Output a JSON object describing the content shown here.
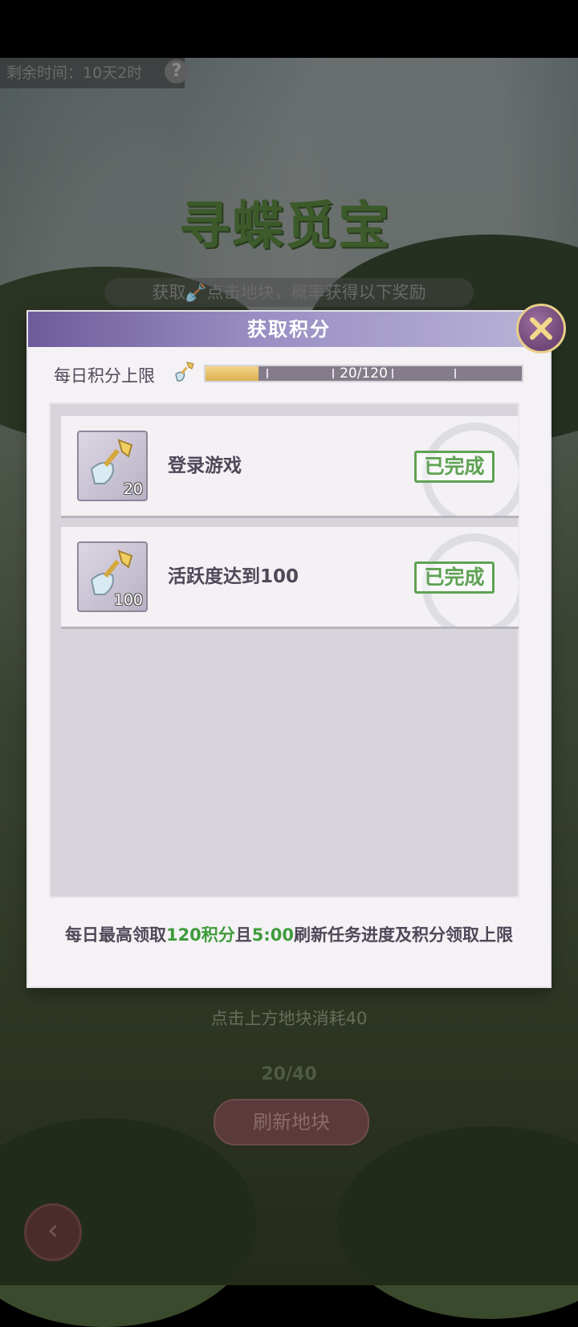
{
  "background": {
    "timer_label": "剩余时间：",
    "timer_value": "10天2时",
    "help_glyph": "?",
    "game_title": "寻蝶觅宝",
    "subtitle": "获取🪏点击地块，概率获得以下奖励",
    "cost_text": "点击上方地块消耗40",
    "count_text": "20/40",
    "refresh_label": "刷新地块",
    "back_glyph": "‹"
  },
  "modal": {
    "title": "获取积分",
    "close_icon": "close-x-icon",
    "daily_limit_label": "每日积分上限",
    "progress": {
      "current": 20,
      "max": 120,
      "text": "20/120"
    },
    "tasks": [
      {
        "label": "登录游戏",
        "reward": "20",
        "status": "已完成"
      },
      {
        "label": "活跃度达到100",
        "reward": "100",
        "status": "已完成"
      }
    ],
    "footer": {
      "part1": "每日最高领取",
      "part2": "120积分",
      "part3": "且",
      "part4": "5:00",
      "part5": "刷新任务进度及积分领取上限"
    }
  },
  "colors": {
    "accent_purple": "#6d5b9a",
    "complete_green": "#5fa254",
    "highlight_green": "#3f9b3c",
    "progress_gold": "#dcb150"
  }
}
